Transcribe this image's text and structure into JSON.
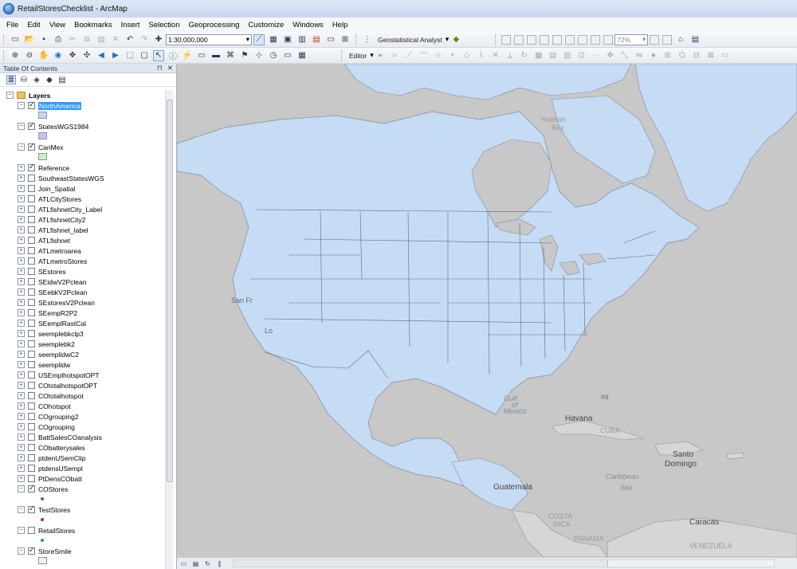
{
  "window": {
    "title": "RetailStoresChecklist - ArcMap"
  },
  "menu": [
    "File",
    "Edit",
    "View",
    "Bookmarks",
    "Insert",
    "Selection",
    "Geoprocessing",
    "Customize",
    "Windows",
    "Help"
  ],
  "toolbar": {
    "scale_value": "1:30,000,000",
    "geostat_label": "Geostatistical Analyst",
    "editor_label": "Editor",
    "zoom_percent": "72%"
  },
  "toc": {
    "title": "Table Of Contents",
    "root_label": "Layers",
    "layers": [
      {
        "name": "NorthAmerica",
        "checked": true,
        "expanded": true,
        "selected": true,
        "swatch": "#c6d8f0"
      },
      {
        "name": "StatesWGS1984",
        "checked": true,
        "expanded": true,
        "swatch": "#c7c3ee"
      },
      {
        "name": "CanMex",
        "checked": true,
        "expanded": true,
        "swatch": "#c9f2c6"
      },
      {
        "name": "Reference",
        "checked": true,
        "expanded": false
      },
      {
        "name": "SoutheastStatesWGS",
        "checked": false,
        "expanded": false
      },
      {
        "name": "Join_Spatial",
        "checked": false,
        "expanded": false
      },
      {
        "name": "ATLCityStores",
        "checked": false,
        "expanded": false
      },
      {
        "name": "ATLfishnetCity_Label",
        "checked": false,
        "expanded": false
      },
      {
        "name": "ATLfishnetCity2",
        "checked": false,
        "expanded": false
      },
      {
        "name": "ATLfishnet_label",
        "checked": false,
        "expanded": false
      },
      {
        "name": "ATLfishnet",
        "checked": false,
        "expanded": false
      },
      {
        "name": "ATLmetroarea",
        "checked": false,
        "expanded": false
      },
      {
        "name": "ATLmetroStores",
        "checked": false,
        "expanded": false
      },
      {
        "name": "SEstores",
        "checked": false,
        "expanded": false
      },
      {
        "name": "SEidwV2Pclean",
        "checked": false,
        "expanded": false
      },
      {
        "name": "SEebkV2Pclean",
        "checked": false,
        "expanded": false
      },
      {
        "name": "SEstoresV2Pclean",
        "checked": false,
        "expanded": false
      },
      {
        "name": "SEempR2P2",
        "checked": false,
        "expanded": false
      },
      {
        "name": "SEemplRastCal",
        "checked": false,
        "expanded": false
      },
      {
        "name": "seemplebkclp3",
        "checked": false,
        "expanded": false
      },
      {
        "name": "seemplebk2",
        "checked": false,
        "expanded": false
      },
      {
        "name": "seemplidwC2",
        "checked": false,
        "expanded": false
      },
      {
        "name": "seemplidw",
        "checked": false,
        "expanded": false
      },
      {
        "name": "USEmplhotspotOPT",
        "checked": false,
        "expanded": false
      },
      {
        "name": "COtotalhotspotOPT",
        "checked": false,
        "expanded": false
      },
      {
        "name": "COtotalhotspot",
        "checked": false,
        "expanded": false
      },
      {
        "name": "COhotspot",
        "checked": false,
        "expanded": false
      },
      {
        "name": "COgrouping2",
        "checked": false,
        "expanded": false
      },
      {
        "name": "COgrouping",
        "checked": false,
        "expanded": false
      },
      {
        "name": "BattSalesCOanalysis",
        "checked": false,
        "expanded": false
      },
      {
        "name": "CObatterysales",
        "checked": false,
        "expanded": false
      },
      {
        "name": "ptdenUSemClip",
        "checked": false,
        "expanded": false
      },
      {
        "name": "ptdensUSempl",
        "checked": false,
        "expanded": false
      },
      {
        "name": "PtDensCObatt",
        "checked": false,
        "expanded": false
      },
      {
        "name": "COStores",
        "checked": true,
        "expanded": true,
        "dot": "#4a7a3a"
      },
      {
        "name": "TestStores",
        "checked": true,
        "expanded": true,
        "dot": "#a0306a"
      },
      {
        "name": "RetailStores",
        "checked": false,
        "expanded": true,
        "dot": "#3a8a8a"
      },
      {
        "name": "StoreSmile",
        "checked": true,
        "expanded": true,
        "swatch": "#eef2f8"
      }
    ]
  },
  "map": {
    "land_color": "#c6dcf5",
    "basemap_color": "#c8c8c8",
    "labels": {
      "havana": "Havana",
      "cuba": "CUBA",
      "santo": "Santo",
      "domingo": "Domingo",
      "gulf": "Gulf",
      "of": "of",
      "mexico": "Mexico",
      "caribbean": "Caribbean",
      "sea": "Sea",
      "guatemala": "Guatemala",
      "costa": "COSTA",
      "rica": "RICA",
      "panama": "PANAMA",
      "caracas": "Caracas",
      "venezuela": "VENEZUELA",
      "sanfr": "San Fr",
      "lo": "Lo",
      "mi": "mi",
      "hudson": "Hudson",
      "bay": "Bay"
    }
  }
}
